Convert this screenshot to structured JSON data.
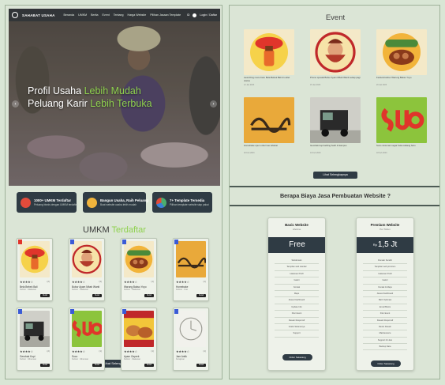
{
  "nav": {
    "brand": "SAHABAT USAHA",
    "menu": [
      "Beranda",
      "UMKM",
      "Berita",
      "Event",
      "Tentang",
      "Harga Website",
      "Pilihan Jasaan Template"
    ],
    "lang": "ID",
    "login": "Login / Daftar"
  },
  "hero": {
    "line1_a": "Profil Usaha ",
    "line1_b": "Lebih Mudah",
    "line2_a": "Peluang Karir ",
    "line2_b": "Lebih Terbuka",
    "prev": "‹",
    "next": "›",
    "highlight_color": "#8fd14f"
  },
  "stats": [
    {
      "title": "1000+ UMKM Terdaftar",
      "sub": "Peluang bisnis dengan UMKM terdaftar",
      "icon": "shop-icon",
      "color": "#e24b3b"
    },
    {
      "title": "Bangun Usaha, Raih Peluang",
      "sub": "Buat website usaha lebih mudah",
      "icon": "handshake-icon",
      "color": "#f0b43c"
    },
    {
      "title": "7+ Template Tersedia",
      "sub": "Pilihan template website siap pakai",
      "icon": "template-icon",
      "color": "#4cae6e"
    }
  ],
  "umkm": {
    "title_a": "UMKM ",
    "title_b": "Terdaftar",
    "more": "Lihat Selengkapnya",
    "cards": [
      {
        "name": "Bela Bebek Bali",
        "sub": "Kuliner · Makanan",
        "stars": "★★★★☆",
        "count": "(2)",
        "btn": "Detail",
        "art": "bela",
        "rank": "#e0352b"
      },
      {
        "name": "Bubur Ayam Mbah Wanti",
        "sub": "Kuliner · Makanan",
        "stars": "★★★★☆",
        "count": "(3)",
        "btn": "Detail",
        "art": "bubur",
        "rank": "#3b5bd6"
      },
      {
        "name": "Warung Bakso Yoyo",
        "sub": "Kuliner · Makanan",
        "stars": "★★★★☆",
        "count": "(1)",
        "btn": "Detail",
        "art": "bakso",
        "rank": "#3b5bd6"
      },
      {
        "name": "Homebake",
        "sub": "Kuliner · Kue",
        "stars": "★★★★☆",
        "count": "(1)",
        "btn": "Detail",
        "art": "homebake",
        "rank": "#3b5bd6"
      },
      {
        "name": "Gerobak Kopi",
        "sub": "Kuliner · Minuman",
        "stars": "★★★★☆",
        "count": "(2)",
        "btn": "Detail",
        "art": "gerobak",
        "rank": "#3b5bd6"
      },
      {
        "name": "Suco",
        "sub": "Kuliner · Minuman",
        "stars": "★★★★☆",
        "count": "(1)",
        "btn": "Detail",
        "art": "suco",
        "rank": "#3b5bd6"
      },
      {
        "name": "Ayam Geprek",
        "sub": "Kuliner · Makanan",
        "stars": "★★★★☆",
        "count": "(1)",
        "btn": "Detail",
        "art": "geprek",
        "rank": "#3b5bd6"
      },
      {
        "name": "Jam Antik",
        "sub": "Kerajinan",
        "stars": "★★★★☆",
        "count": "(1)",
        "btn": "Detail",
        "art": "jam",
        "rank": "#3b5bd6"
      }
    ]
  },
  "event": {
    "title": "Event",
    "more": "Lihat Selengkapnya",
    "items": [
      {
        "cap": "Launching menu baru Bela Bebek Bali di outlet utama",
        "meta": "12 Jan 2023",
        "art": "bela"
      },
      {
        "cap": "Promo spesial Bubur Ayam Mbah Wanti setiap pagi",
        "meta": "15 Jan 2023",
        "art": "bubur"
      },
      {
        "cap": "Festival kuliner Warung Bakso Yoyo",
        "meta": "20 Jan 2023",
        "art": "bakso"
      },
      {
        "cap": "Homebake open order kue lebaran",
        "meta": "02 Feb 2023",
        "art": "homebake"
      },
      {
        "cap": "Gerobak kopi keliling hadir di kampus",
        "meta": "10 Feb 2023",
        "art": "gerobak"
      },
      {
        "cap": "Suco minuman segar buka cabang baru",
        "meta": "18 Feb 2023",
        "art": "suco"
      }
    ]
  },
  "pricing": {
    "title": "Berapa Biaya Jasa Pembuatan Website ?",
    "plans": [
      {
        "name": "Basic Website",
        "sub": "Lifetime",
        "currency": "",
        "price": "Free",
        "features": [
          "Subdomain",
          "Tampilan web standar",
          "Halaman Profil",
          "Galeri",
          "Kontak",
          "Maps",
          "Akses Dashboard",
          "Update Info",
          "Fitur Event",
          "Desain Responsif",
          "Gratis Selamanya",
          "Support"
        ],
        "cta": "Order Sekarang"
      },
      {
        "name": "Premium Website",
        "sub": "Per Tahun",
        "currency": "Rp",
        "price": "1,5 Jt",
        "features": [
          "Domain Sendiri",
          "Tampilan web premium",
          "Halaman Profil",
          "Galeri",
          "Kontak & Maps",
          "Akses Dashboard",
          "SEO Optimasi",
          "Email Bisnis",
          "Fitur Event",
          "Desain Responsif",
          "Revisi Desain",
          "Maintenance",
          "Support 24 Jam",
          "Backup Data"
        ],
        "cta": "Order Sekarang"
      }
    ]
  }
}
